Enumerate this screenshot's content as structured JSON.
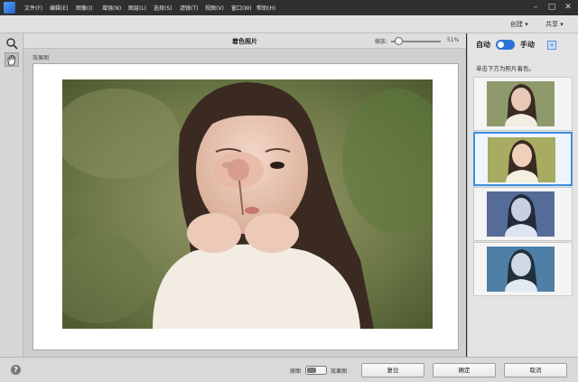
{
  "menubar": {
    "items": [
      "文件(F)",
      "编辑(E)",
      "图像(I)",
      "增强(N)",
      "图层(L)",
      "选择(S)",
      "滤镜(T)",
      "视图(V)",
      "窗口(W)",
      "帮助(H)"
    ],
    "minimize": "–",
    "maximize": "□",
    "close": "✕"
  },
  "actionbar": {
    "create_label": "创建",
    "share_label": "共享"
  },
  "main": {
    "title": "着色照片",
    "zoom_label": "缩放:",
    "zoom_value": "51%",
    "view_label": "效果图"
  },
  "panel": {
    "auto_label": "自动",
    "manual_label": "手动",
    "instruction": "单击下方为照片着色。",
    "thumbnails": [
      {
        "tint": "#9aa27a",
        "selected": false
      },
      {
        "tint": "#b7b86f",
        "selected": true
      },
      {
        "tint": "#5f77a8",
        "selected": false
      },
      {
        "tint": "#5d8ab3",
        "selected": false
      }
    ]
  },
  "bottombar": {
    "before_label": "原图",
    "after_label": "效果图",
    "reset_label": "复位",
    "ok_label": "确定",
    "cancel_label": "取消"
  }
}
